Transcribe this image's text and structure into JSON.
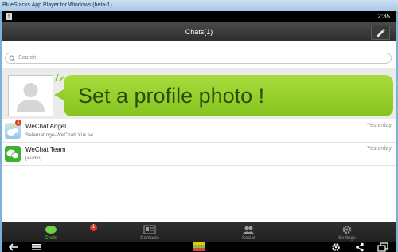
{
  "window": {
    "title": "BlueStacks App Player for Windows (beta-1)"
  },
  "statusbar": {
    "notification": "!",
    "time": "2:35"
  },
  "header": {
    "title": "Chats(1)"
  },
  "search": {
    "placeholder": "Search"
  },
  "banner": {
    "text": "Set a profile photo !"
  },
  "chats": [
    {
      "name": "WeChat Angel",
      "message": "Selamat nge-WeChat!  Yuk se...",
      "time": "Yesterday",
      "badge": "1"
    },
    {
      "name": "WeChat Team",
      "message": "[Audio]",
      "time": "Yesterday"
    }
  ],
  "tabs": [
    {
      "label": "Chats",
      "active": true,
      "badge": "1"
    },
    {
      "label": "Contacts"
    },
    {
      "label": "Social"
    },
    {
      "label": "Settings"
    }
  ],
  "colors": {
    "accent_green": "#86c41f",
    "active_tab": "#6fd040",
    "badge_red": "#e23a2a"
  }
}
